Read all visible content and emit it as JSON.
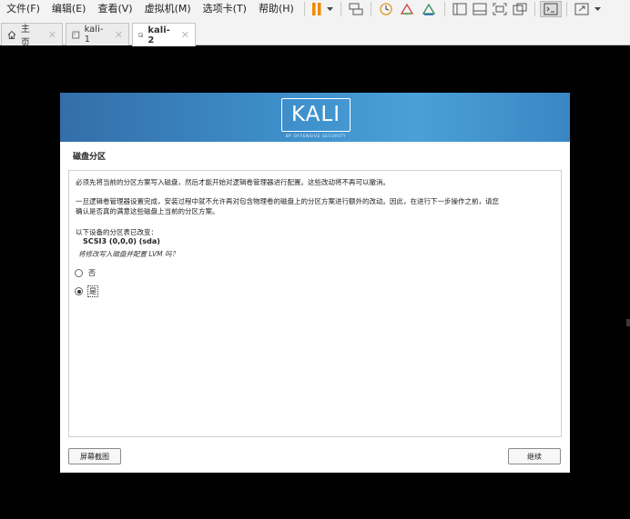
{
  "menubar": {
    "items": [
      "文件(F)",
      "编辑(E)",
      "查看(V)",
      "虚拟机(M)",
      "选项卡(T)",
      "帮助(H)"
    ]
  },
  "tabs": [
    {
      "label": "主页",
      "icon": "home-icon"
    },
    {
      "label": "kali-1",
      "icon": "vm-icon"
    },
    {
      "label": "kali-2",
      "icon": "vm-running-icon",
      "active": true
    }
  ],
  "installer": {
    "logo": "KALI",
    "tagline": "BY OFFENSIVE SECURITY",
    "title": "磁盘分区",
    "para1": "必须先将当前的分区方案写入磁盘，然后才能开始对逻辑卷管理器进行配置。这些改动将不再可以撤消。",
    "para2_line1": "一旦逻辑卷管理器设置完成，安装过程中就不允许再对包含物理卷的磁盘上的分区方案进行额外的改动。因此，在进行下一步操作之前，请您",
    "para2_line2": "确认是否真的满意这些磁盘上当前的分区方案。",
    "changed_label": "以下设备的分区表已改变：",
    "device": "SCSI3 (0,0,0) (sda)",
    "question": "将修改写入磁盘并配置 LVM 吗？",
    "options": [
      {
        "label": "否",
        "selected": false
      },
      {
        "label": "是",
        "selected": true
      }
    ],
    "screenshot_button": "屏幕截图",
    "continue_button": "继续"
  },
  "colors": {
    "banner_start": "#346ea8",
    "banner_end": "#4aa0d8",
    "pause_icon": "#f08a00"
  }
}
